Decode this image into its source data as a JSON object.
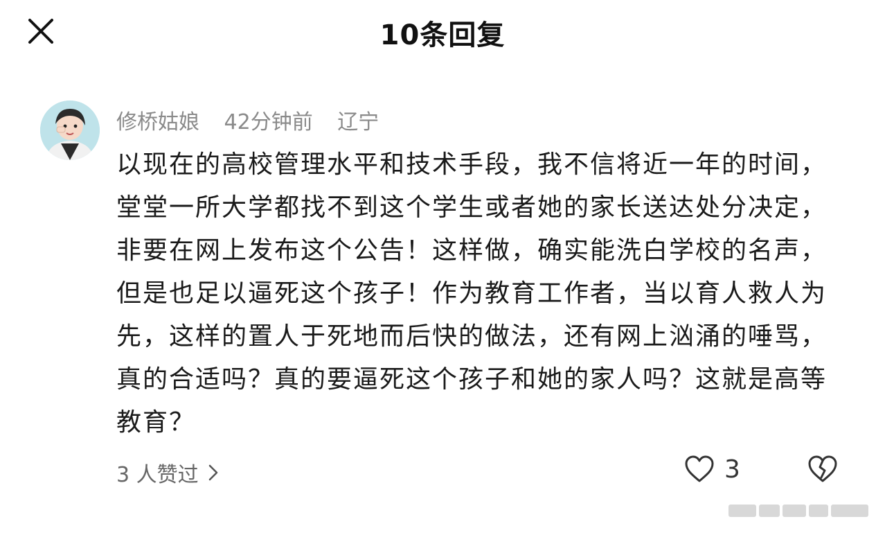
{
  "header": {
    "title": "10条回复",
    "close_icon": "close-icon"
  },
  "comment": {
    "username": "修桥姑娘",
    "time": "42分钟前",
    "location": "辽宁",
    "text": "以现在的高校管理水平和技术手段，我不信将近一年的时间，堂堂一所大学都找不到这个学生或者她的家长送达处分决定，非要在网上发布这个公告！这样做，确实能洗白学校的名声，但是也足以逼死这个孩子！作为教育工作者，当以育人救人为先，这样的置人于死地而后快的做法，还有网上汹涌的唾骂，真的合适吗？真的要逼死这个孩子和她的家人吗？这就是高等教育？",
    "likers_label": "3 人赞过",
    "like_count": "3",
    "icons": [
      "avatar",
      "chevron-right-icon",
      "heart-icon",
      "broken-heart-icon"
    ]
  },
  "colors": {
    "text": "#1a1a1a",
    "meta": "#8a8a8a",
    "avatar_bg": "#bfe3ea"
  }
}
